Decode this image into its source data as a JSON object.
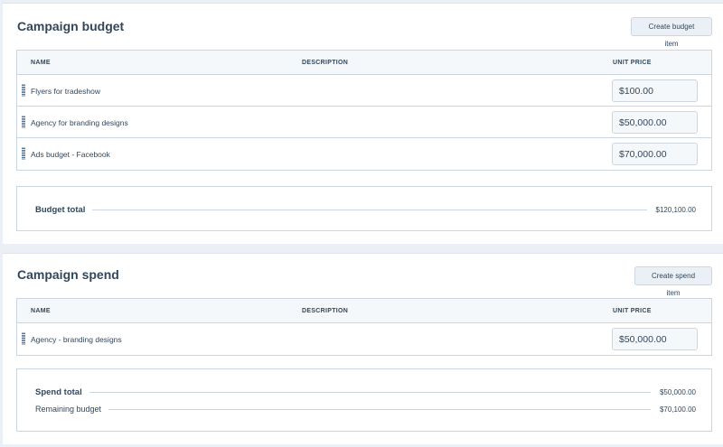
{
  "budget": {
    "title": "Campaign budget",
    "create_button": "Create budget item",
    "columns": {
      "name": "NAME",
      "description": "DESCRIPTION",
      "unit_price": "UNIT PRICE"
    },
    "items": [
      {
        "name": "Flyers for tradeshow",
        "price": "$100.00"
      },
      {
        "name": "Agency for branding designs",
        "price": "$50,000.00"
      },
      {
        "name": "Ads budget - Facebook",
        "price": "$70,000.00"
      }
    ],
    "total_label": "Budget total",
    "total_value": "$120,100.00"
  },
  "spend": {
    "title": "Campaign spend",
    "create_button": "Create spend item",
    "columns": {
      "name": "NAME",
      "description": "DESCRIPTION",
      "unit_price": "UNIT PRICE"
    },
    "items": [
      {
        "name": "Agency - branding designs",
        "price": "$50,000.00"
      }
    ],
    "total_label": "Spend total",
    "total_value": "$50,000.00",
    "remaining_label": "Remaining budget",
    "remaining_value": "$70,100.00"
  },
  "icons": {
    "drag_handle": "drag-handle-icon"
  },
  "colors": {
    "text": "#33475b",
    "border": "#cbd6e2",
    "background": "#eaf0f6",
    "header": "#f5f8fa"
  }
}
